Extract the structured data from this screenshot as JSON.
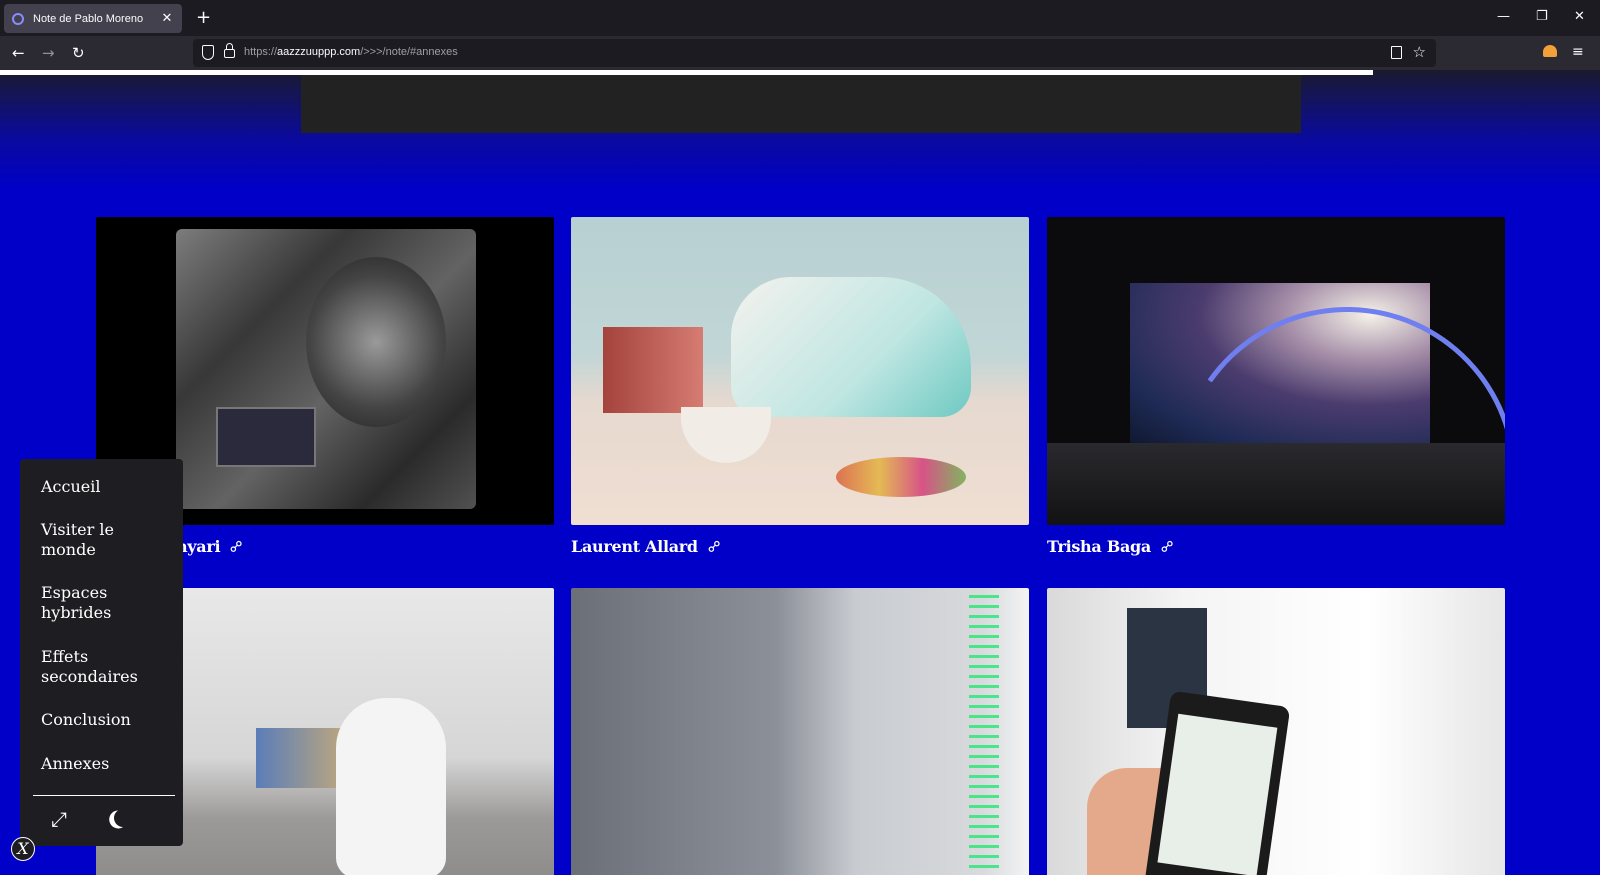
{
  "browser": {
    "tab_title": "Note de Pablo Moreno",
    "tab_close": "✕",
    "new_tab": "+",
    "window_controls": {
      "minimize": "—",
      "restore": "❐",
      "close": "✕"
    },
    "nav": {
      "back": "←",
      "forward": "→",
      "reload": "↻"
    },
    "url_prefix": "https://",
    "url_host": "aazzzuuppp.com",
    "url_path": "/>>>/note/#annexes",
    "star": "☆",
    "menu": "≡"
  },
  "page": {
    "cards": [
      {
        "name": "Nika Allahyari",
        "image_label": "gray-relief-sculpture-photo"
      },
      {
        "name": "Laurent Allard",
        "image_label": "teapot-sneaker-still-life-photo"
      },
      {
        "name": "Trisha Baga",
        "image_label": "projection-installation-photo"
      },
      {
        "name": "",
        "image_label": "gallery-bear-sculpture-photo"
      },
      {
        "name": "",
        "image_label": "green-light-room-photo"
      },
      {
        "name": "",
        "image_label": "phone-corridor-photo"
      }
    ],
    "link_glyph": "⚯"
  },
  "sidemenu": {
    "items": [
      "Accueil",
      "Visiter le monde",
      "Espaces hybrides",
      "Effets secondaires",
      "Conclusion",
      "Annexes"
    ],
    "expand_icon": "⤢",
    "toggle_label": "X"
  }
}
